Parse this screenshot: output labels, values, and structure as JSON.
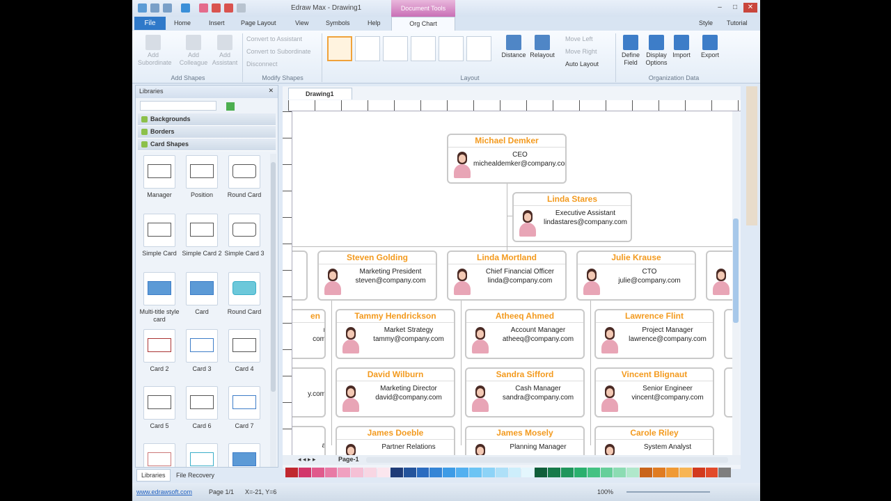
{
  "window": {
    "title": "Edraw Max - Drawing1",
    "context_tab": "Document Tools"
  },
  "tabs": {
    "file": "File",
    "home": "Home",
    "insert": "Insert",
    "page_layout": "Page Layout",
    "view": "View",
    "symbols": "Symbols",
    "help": "Help",
    "org_chart": "Org Chart",
    "style": "Style",
    "tutorial": "Tutorial"
  },
  "ribbon": {
    "add_subordinate": "Add Subordinate",
    "add_colleague": "Add Colleague",
    "add_assistant": "Add Assistant",
    "convert_assistant": "Convert to Assistant",
    "convert_subordinate": "Convert to Subordinate",
    "disconnect": "Disconnect",
    "distance": "Distance",
    "relayout": "Relayout",
    "move_left": "Move Left",
    "move_right": "Move Right",
    "auto_layout": "Auto Layout",
    "define_field": "Define Field",
    "display_options": "Display Options",
    "import": "Import",
    "export": "Export",
    "group_add_shapes": "Add Shapes",
    "group_modify_shapes": "Modify Shapes",
    "group_layout": "Layout",
    "group_org_data": "Organization Data"
  },
  "libraries": {
    "title": "Libraries",
    "categories": [
      "Backgrounds",
      "Borders",
      "Card Shapes"
    ],
    "shapes": [
      "Manager",
      "Position",
      "Round Card",
      "Simple Card",
      "Simple Card 2",
      "Simple Card 3",
      "Multi-title style card",
      "Card",
      "Round Card",
      "Card 2",
      "Card 3",
      "Card 4",
      "Card 5",
      "Card 6",
      "Card 7"
    ],
    "tab_libraries": "Libraries",
    "tab_recovery": "File Recovery"
  },
  "document": {
    "tab": "Drawing1",
    "page_tab": "Page-1"
  },
  "cards": [
    {
      "name": "Michael Demker",
      "title": "CEO",
      "email": "michealdemker@company.com"
    },
    {
      "name": "Linda Stares",
      "title": "Executive Assistant",
      "email": "lindastares@company.com"
    },
    {
      "name": "Steven Golding",
      "title": "Marketing President",
      "email": "steven@company.com"
    },
    {
      "name": "Linda Mortland",
      "title": "Chief Financial Officer",
      "email": "linda@company.com"
    },
    {
      "name": "Julie Krause",
      "title": "CTO",
      "email": "julie@company.com"
    },
    {
      "name": "Tammy Hendrickson",
      "title": "Market Strategy",
      "email": "tammy@company.com"
    },
    {
      "name": "Atheeq Ahmed",
      "title": "Account Manager",
      "email": "atheeq@company.com"
    },
    {
      "name": "Lawrence Flint",
      "title": "Project Manager",
      "email": "lawrence@company.com"
    },
    {
      "name": "David Wilburn",
      "title": "Marketing Director",
      "email": "david@company.com"
    },
    {
      "name": "Sandra Sifford",
      "title": "Cash Manager",
      "email": "sandra@company.com"
    },
    {
      "name": "Vincent Blignaut",
      "title": "Senior Engineer",
      "email": "vincent@company.com"
    },
    {
      "name": "James Doeble",
      "title": "Partner Relations",
      "email": ""
    },
    {
      "name": "James Mosely",
      "title": "Planning Manager",
      "email": ""
    },
    {
      "name": "Carole Riley",
      "title": "System Analyst",
      "email": ""
    }
  ],
  "partial": {
    "left1": "en",
    "left2": "r",
    "left3": "com",
    "left4": "y.com",
    "left5": "a"
  },
  "status": {
    "site": "www.edrawsoft.com",
    "page": "Page 1/1",
    "coords": "X=-21, Y=6",
    "zoom": "100%"
  },
  "palette": [
    "#c0282f",
    "#d2376b",
    "#e05a8c",
    "#e87aa5",
    "#f0a0c0",
    "#f5c0d5",
    "#f8d6e3",
    "#fbe6ee",
    "#1f3c78",
    "#24549c",
    "#2b6cc0",
    "#3485d6",
    "#3d9be6",
    "#53b0f0",
    "#6cc4f4",
    "#8dd3f7",
    "#aee0f8",
    "#cdeefb",
    "#e4f6fd",
    "#0f5e3a",
    "#177a4a",
    "#1f965c",
    "#2ab06e",
    "#44c283",
    "#66cf9a",
    "#8cdcb3",
    "#b0e8cb",
    "#c9651b",
    "#e07c22",
    "#f09a35",
    "#f7b555",
    "#d23a1e",
    "#e24a2a",
    "#7e7e7e"
  ]
}
